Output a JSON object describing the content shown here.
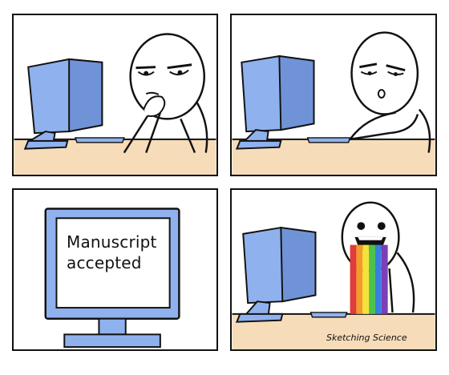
{
  "panels": [
    {
      "id": "top-left",
      "scene": "thinking-at-computer",
      "emotion": "skeptical"
    },
    {
      "id": "top-right",
      "scene": "typing-at-computer",
      "emotion": "suspicious"
    },
    {
      "id": "bottom-left",
      "scene": "monitor-closeup",
      "screen_text": {
        "line1": "Manuscript",
        "line2": "accepted"
      }
    },
    {
      "id": "bottom-right",
      "scene": "rainbow-vomit",
      "emotion": "ecstatic"
    }
  ],
  "signature": "Sketching Science",
  "colors": {
    "monitor": "#8fb1ee",
    "monitor_dark": "#6f93d6",
    "desk": "#f7dcb9",
    "outline": "#111111",
    "rainbow": [
      "#e23b3b",
      "#f39a28",
      "#f4e23a",
      "#4cc24a",
      "#3a7fe0",
      "#7b3fb8"
    ]
  }
}
